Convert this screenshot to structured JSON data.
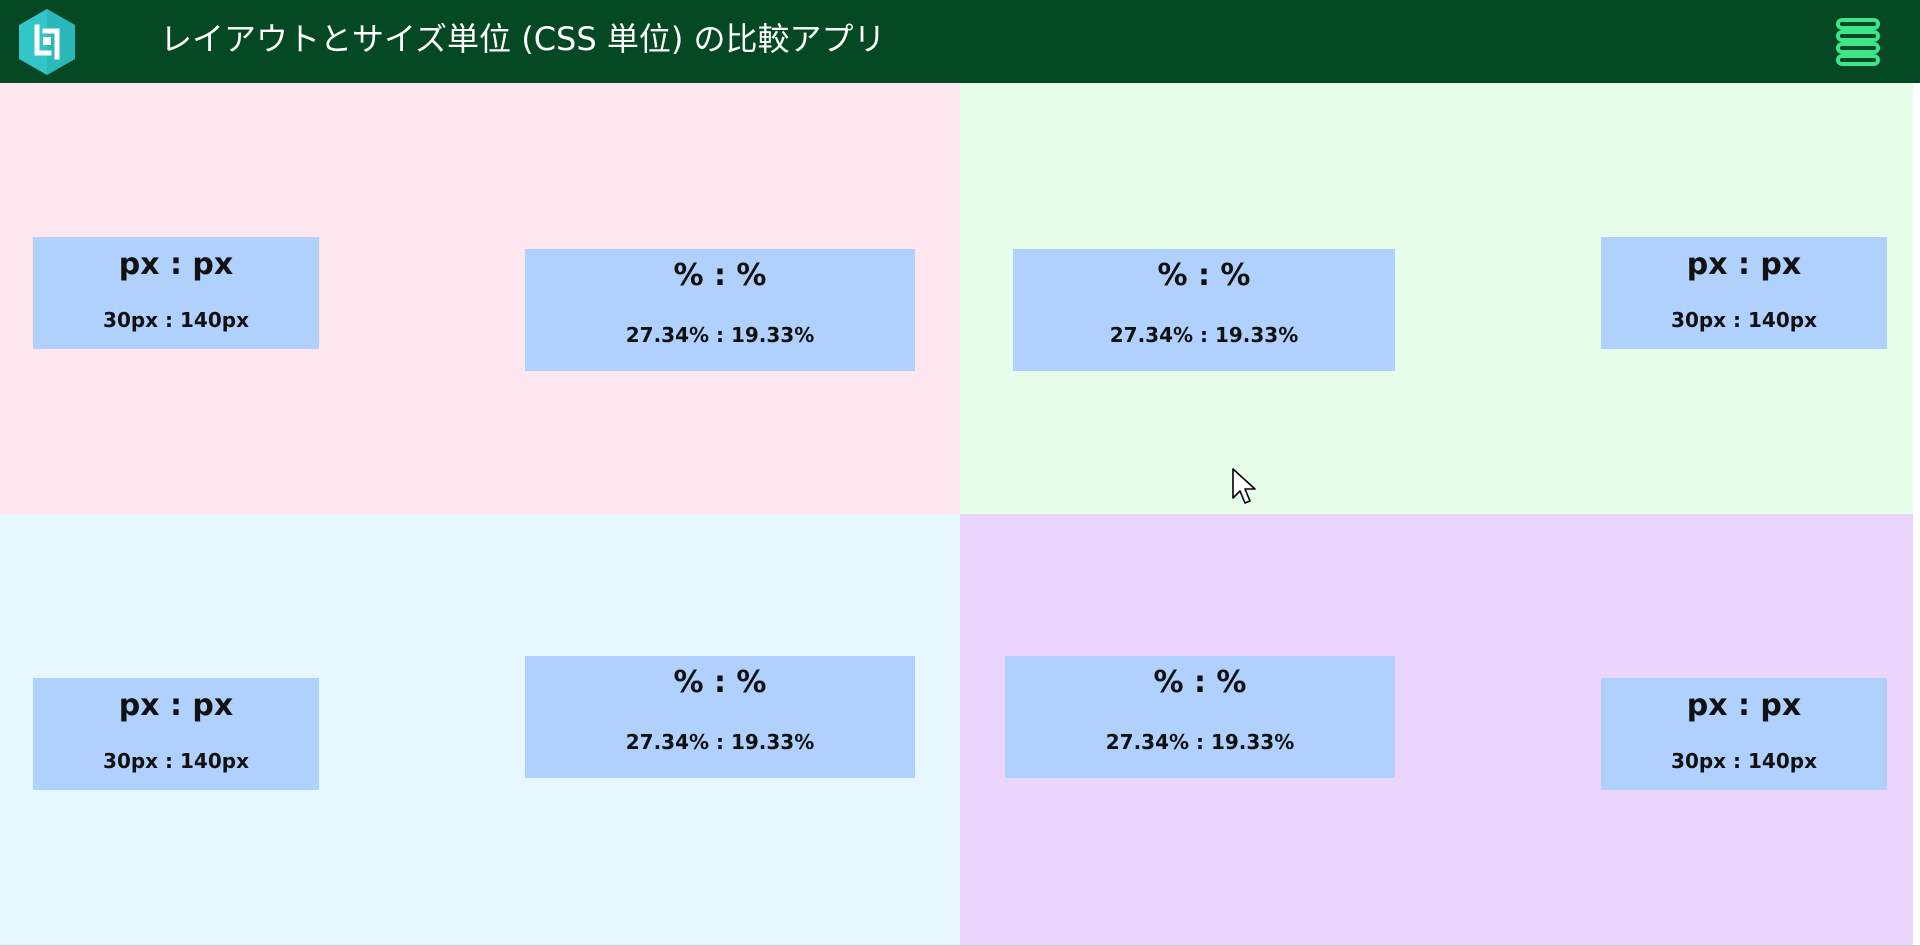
{
  "header": {
    "title": "レイアウトとサイズ単位 (CSS 単位) の比較アプリ",
    "logo_icon": "app-logo-icon",
    "menu_icon": "hamburger-menu-icon",
    "background": "#044923",
    "accent": "#3ee38a"
  },
  "panels": {
    "top_left": {
      "background": "#fde6ee",
      "px_box": {
        "heading": "px : px",
        "values": "30px : 140px"
      },
      "pct_box": {
        "heading": "% : %",
        "values": "27.34% : 19.33%"
      }
    },
    "top_right": {
      "background": "#e6fde9",
      "pct_box": {
        "heading": "% : %",
        "values": "27.34% : 19.33%"
      },
      "px_box": {
        "heading": "px : px",
        "values": "30px : 140px"
      }
    },
    "bottom_left": {
      "background": "#e6f7fd",
      "px_box": {
        "heading": "px : px",
        "values": "30px : 140px"
      },
      "pct_box": {
        "heading": "% : %",
        "values": "27.34% : 19.33%"
      }
    },
    "bottom_right": {
      "background": "#ead6fd",
      "pct_box": {
        "heading": "% : %",
        "values": "27.34% : 19.33%"
      },
      "px_box": {
        "heading": "px : px",
        "values": "30px : 140px"
      }
    }
  },
  "box_color": "#b0d1fd"
}
